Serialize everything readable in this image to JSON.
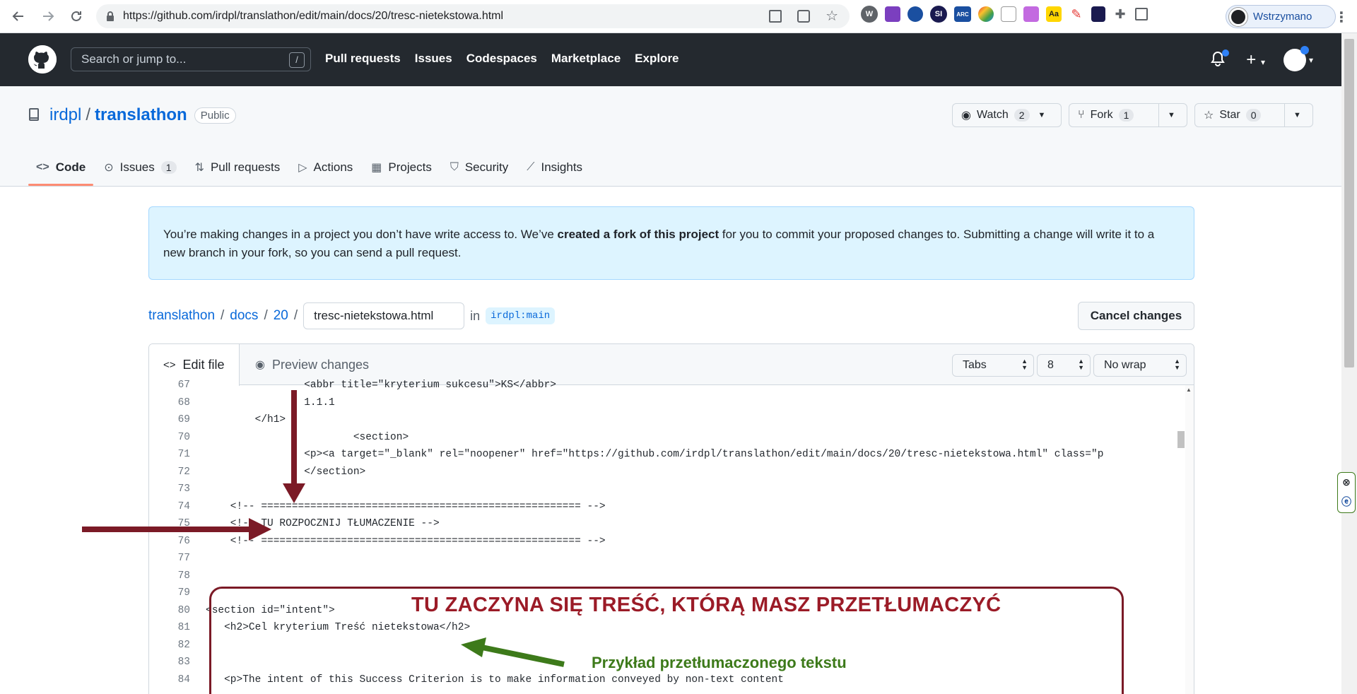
{
  "browser": {
    "url": "https://github.com/irdpl/translathon/edit/main/docs/20/tresc-nietekstowa.html",
    "profile_label": "Wstrzymano",
    "extensions": [
      "W",
      "SI",
      "ARC",
      "Aa"
    ]
  },
  "header": {
    "search_placeholder": "Search or jump to...",
    "search_shortcut": "/",
    "nav": [
      "Pull requests",
      "Issues",
      "Codespaces",
      "Marketplace",
      "Explore"
    ]
  },
  "repo": {
    "owner": "irdpl",
    "separator": "/",
    "name": "translathon",
    "visibility": "Public",
    "watch_label": "Watch",
    "watch_count": "2",
    "fork_label": "Fork",
    "fork_count": "1",
    "star_label": "Star",
    "star_count": "0",
    "tabs": [
      {
        "label": "Code",
        "icon": "code-icon"
      },
      {
        "label": "Issues",
        "icon": "issue-icon",
        "count": "1"
      },
      {
        "label": "Pull requests",
        "icon": "pull-request-icon"
      },
      {
        "label": "Actions",
        "icon": "play-icon"
      },
      {
        "label": "Projects",
        "icon": "table-icon"
      },
      {
        "label": "Security",
        "icon": "shield-icon"
      },
      {
        "label": "Insights",
        "icon": "graph-icon"
      }
    ]
  },
  "notice": {
    "part1": "You’re making changes in a project you don’t have write access to. We’ve ",
    "bold": "created a fork of this project",
    "part2": " for you to commit your proposed changes to. Submitting a change will write it to a new branch in your fork, so you can send a pull request."
  },
  "breadcrumb": {
    "repo": "translathon",
    "dir1": "docs",
    "dir2": "20",
    "sep": "/",
    "filename": "tresc-nietekstowa.html",
    "in_label": "in",
    "branch": "irdpl:main"
  },
  "cancel_label": "Cancel changes",
  "editor": {
    "edit_tab": "Edit file",
    "preview_tab": "Preview changes",
    "indent_mode": "Tabs",
    "indent_size": "8",
    "wrap_mode": "No wrap"
  },
  "code_lines": [
    {
      "n": "67",
      "t": "                <abbr title=\"kryterium sukcesu\">KS</abbr>"
    },
    {
      "n": "68",
      "t": "                1.1.1"
    },
    {
      "n": "69",
      "t": "        </h1>"
    },
    {
      "n": "70",
      "t": "                        <section>"
    },
    {
      "n": "71",
      "t": "                <p><a target=\"_blank\" rel=\"noopener\" href=\"https://github.com/irdpl/translathon/edit/main/docs/20/tresc-nietekstowa.html\" class=\"p"
    },
    {
      "n": "72",
      "t": "                </section>"
    },
    {
      "n": "73",
      "t": ""
    },
    {
      "n": "74",
      "t": "    <!-- ==================================================== -->"
    },
    {
      "n": "75",
      "t": "    <!-- TU ROZPOCZNIJ TŁUMACZENIE -->"
    },
    {
      "n": "76",
      "t": "    <!-- ==================================================== -->"
    },
    {
      "n": "77",
      "t": ""
    },
    {
      "n": "78",
      "t": ""
    },
    {
      "n": "79",
      "t": ""
    },
    {
      "n": "80",
      "t": "<section id=\"intent\">"
    },
    {
      "n": "81",
      "t": "   <h2>Cel kryterium Treść nietekstowa</h2>"
    },
    {
      "n": "82",
      "t": ""
    },
    {
      "n": "83",
      "t": ""
    },
    {
      "n": "84",
      "t": "   <p>The intent of this Success Criterion is to make information conveyed by non-text content"
    }
  ],
  "annotations": {
    "heading": "TU ZACZYNA SIĘ TREŚĆ, KTÓRĄ MASZ PRZETŁUMACZYĆ",
    "sample": "Przykład przetłumaczonego tekstu"
  },
  "colors": {
    "annotation_red": "#7b1a26",
    "annotation_green": "#3d7a1a",
    "header_bg": "#24292f",
    "link": "#0969da"
  }
}
